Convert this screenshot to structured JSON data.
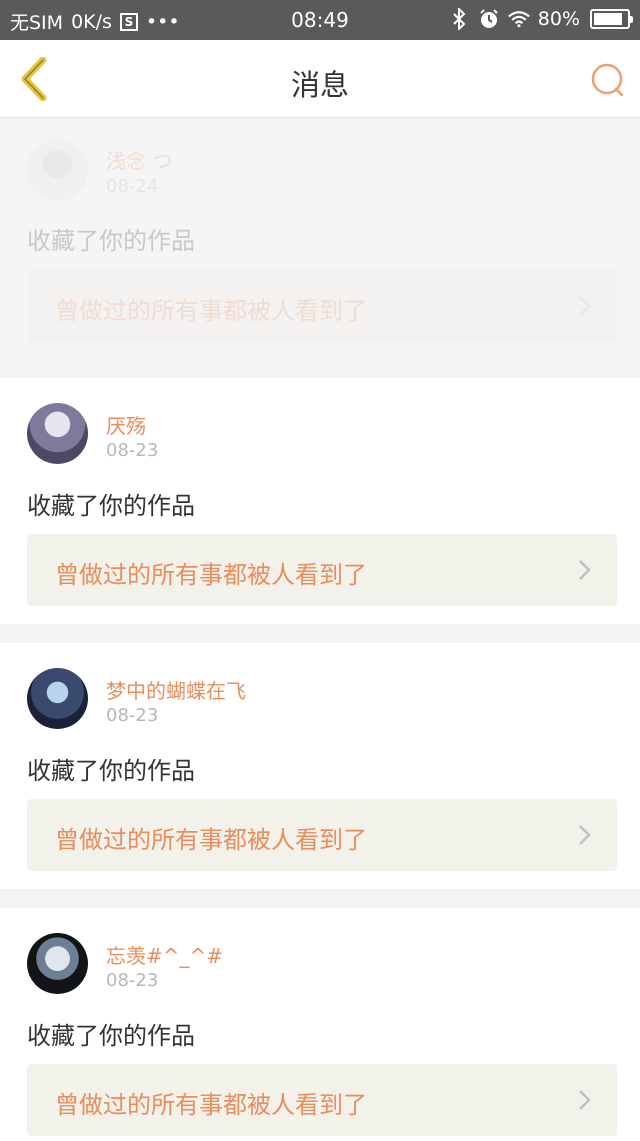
{
  "status_bar": {
    "carrier": "无SIM",
    "speed": "0K/s",
    "s_icon": "S",
    "dots": "•••",
    "time": "08:49",
    "battery": "80%"
  },
  "nav": {
    "title": "消息",
    "back_icon": "chevron-left",
    "search_icon": "search"
  },
  "messages": [
    {
      "user": "浅念 つ",
      "date": "08-24",
      "action": "收藏了你的作品",
      "work_title": "曾做过的所有事都被人看到了"
    },
    {
      "user": "厌殇",
      "date": "08-23",
      "action": "收藏了你的作品",
      "work_title": "曾做过的所有事都被人看到了"
    },
    {
      "user": "梦中的蝴蝶在飞",
      "date": "08-23",
      "action": "收藏了你的作品",
      "work_title": "曾做过的所有事都被人看到了"
    },
    {
      "user": "忘羡#^_^#",
      "date": "08-23",
      "action": "收藏了你的作品",
      "work_title": "曾做过的所有事都被人看到了"
    }
  ],
  "colors": {
    "accent": "#e98d5d",
    "back_icon": "#e9c33a",
    "work_bg": "#f3f2ea"
  }
}
